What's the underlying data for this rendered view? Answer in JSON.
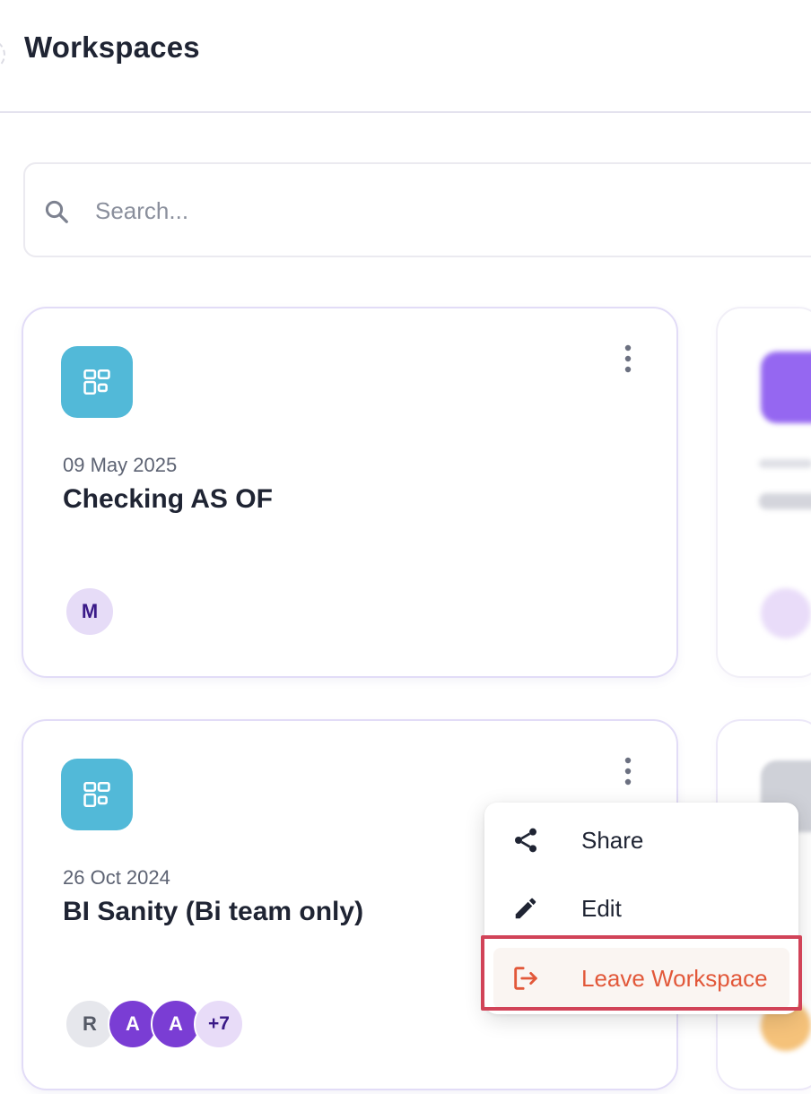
{
  "header": {
    "title": "Workspaces"
  },
  "search": {
    "placeholder": "Search...",
    "icon": "search-icon"
  },
  "workspaces": [
    {
      "date": "09 May 2025",
      "name": "Checking AS OF",
      "icon": "dashboard-grid-icon",
      "members": [
        {
          "initial": "M"
        }
      ]
    },
    {
      "date": "26 Oct 2024",
      "name": "BI Sanity (Bi team only)",
      "icon": "dashboard-grid-icon",
      "members": [
        {
          "initial": "R"
        },
        {
          "initial": "A"
        },
        {
          "initial": "A"
        }
      ],
      "more_members": "+7"
    }
  ],
  "context_menu": {
    "items": [
      {
        "label": "Share",
        "icon": "share-icon"
      },
      {
        "label": "Edit",
        "icon": "pencil-icon"
      },
      {
        "label": "Leave Workspace",
        "icon": "logout-icon"
      }
    ]
  },
  "colors": {
    "accent_icon_bg": "#52b9d8",
    "avatar_purple": "#7a3dd4",
    "leave_text": "#e2583a",
    "highlight_border": "#d14358"
  }
}
